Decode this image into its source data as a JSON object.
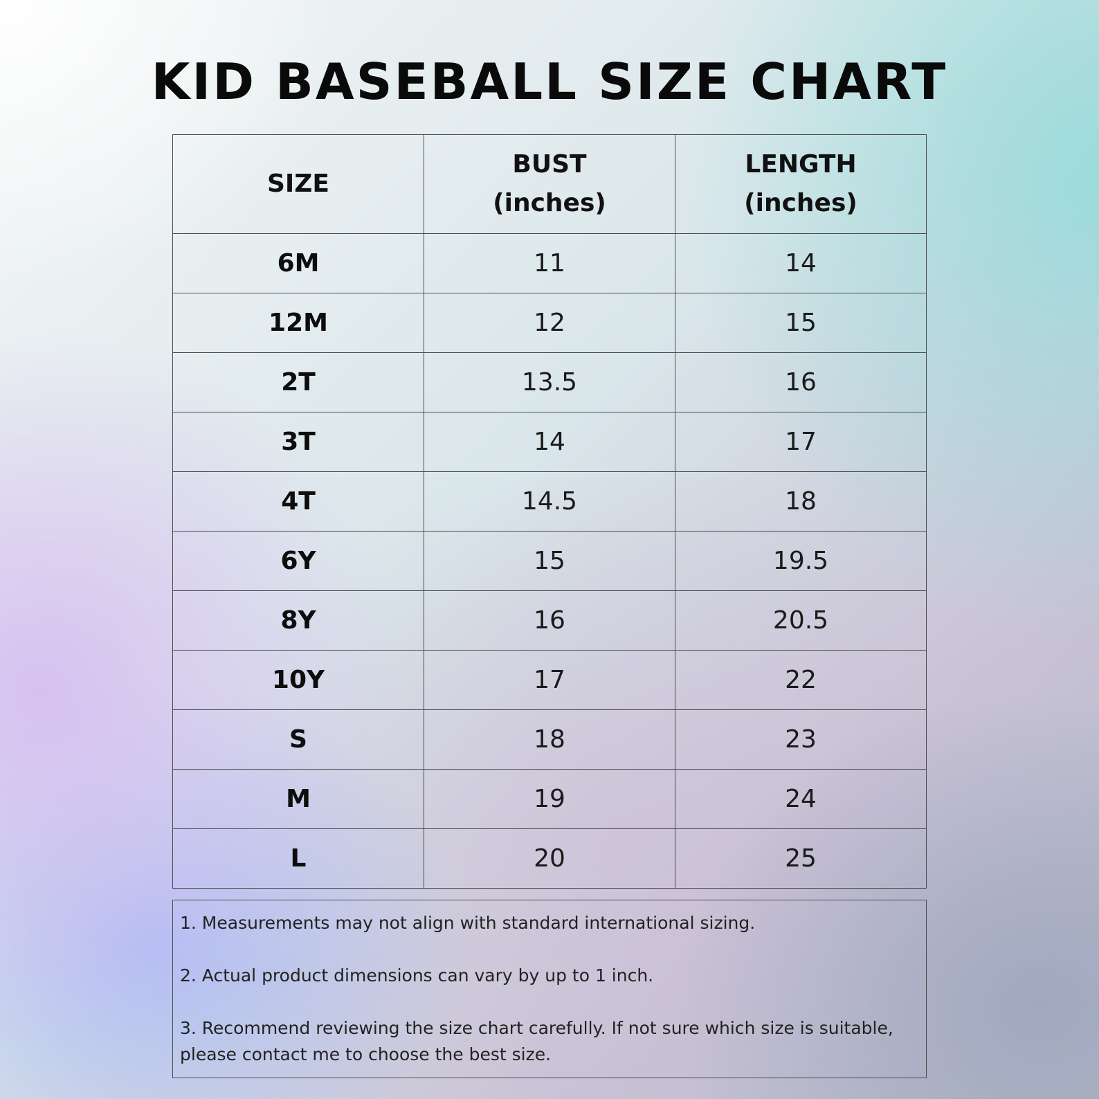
{
  "title": "KID BASEBALL SIZE CHART",
  "table": {
    "headers": [
      {
        "line1": "SIZE",
        "line2": ""
      },
      {
        "line1": "BUST",
        "line2": "(inches)"
      },
      {
        "line1": "LENGTH",
        "line2": "(inches)"
      }
    ],
    "rows": [
      {
        "size": "6M",
        "bust": "11",
        "length": "14"
      },
      {
        "size": "12M",
        "bust": "12",
        "length": "15"
      },
      {
        "size": "2T",
        "bust": "13.5",
        "length": "16"
      },
      {
        "size": "3T",
        "bust": "14",
        "length": "17"
      },
      {
        "size": "4T",
        "bust": "14.5",
        "length": "18"
      },
      {
        "size": "6Y",
        "bust": "15",
        "length": "19.5"
      },
      {
        "size": "8Y",
        "bust": "16",
        "length": "20.5"
      },
      {
        "size": "10Y",
        "bust": "17",
        "length": "22"
      },
      {
        "size": "S",
        "bust": "18",
        "length": "23"
      },
      {
        "size": "M",
        "bust": "19",
        "length": "24"
      },
      {
        "size": "L",
        "bust": "20",
        "length": "25"
      }
    ]
  },
  "notes": [
    "1. Measurements may not align with standard international sizing.",
    "2. Actual product dimensions can vary by up to 1 inch.",
    "3. Recommend reviewing the size chart carefully. If not sure which size is suitable, please contact me to choose the best size."
  ]
}
